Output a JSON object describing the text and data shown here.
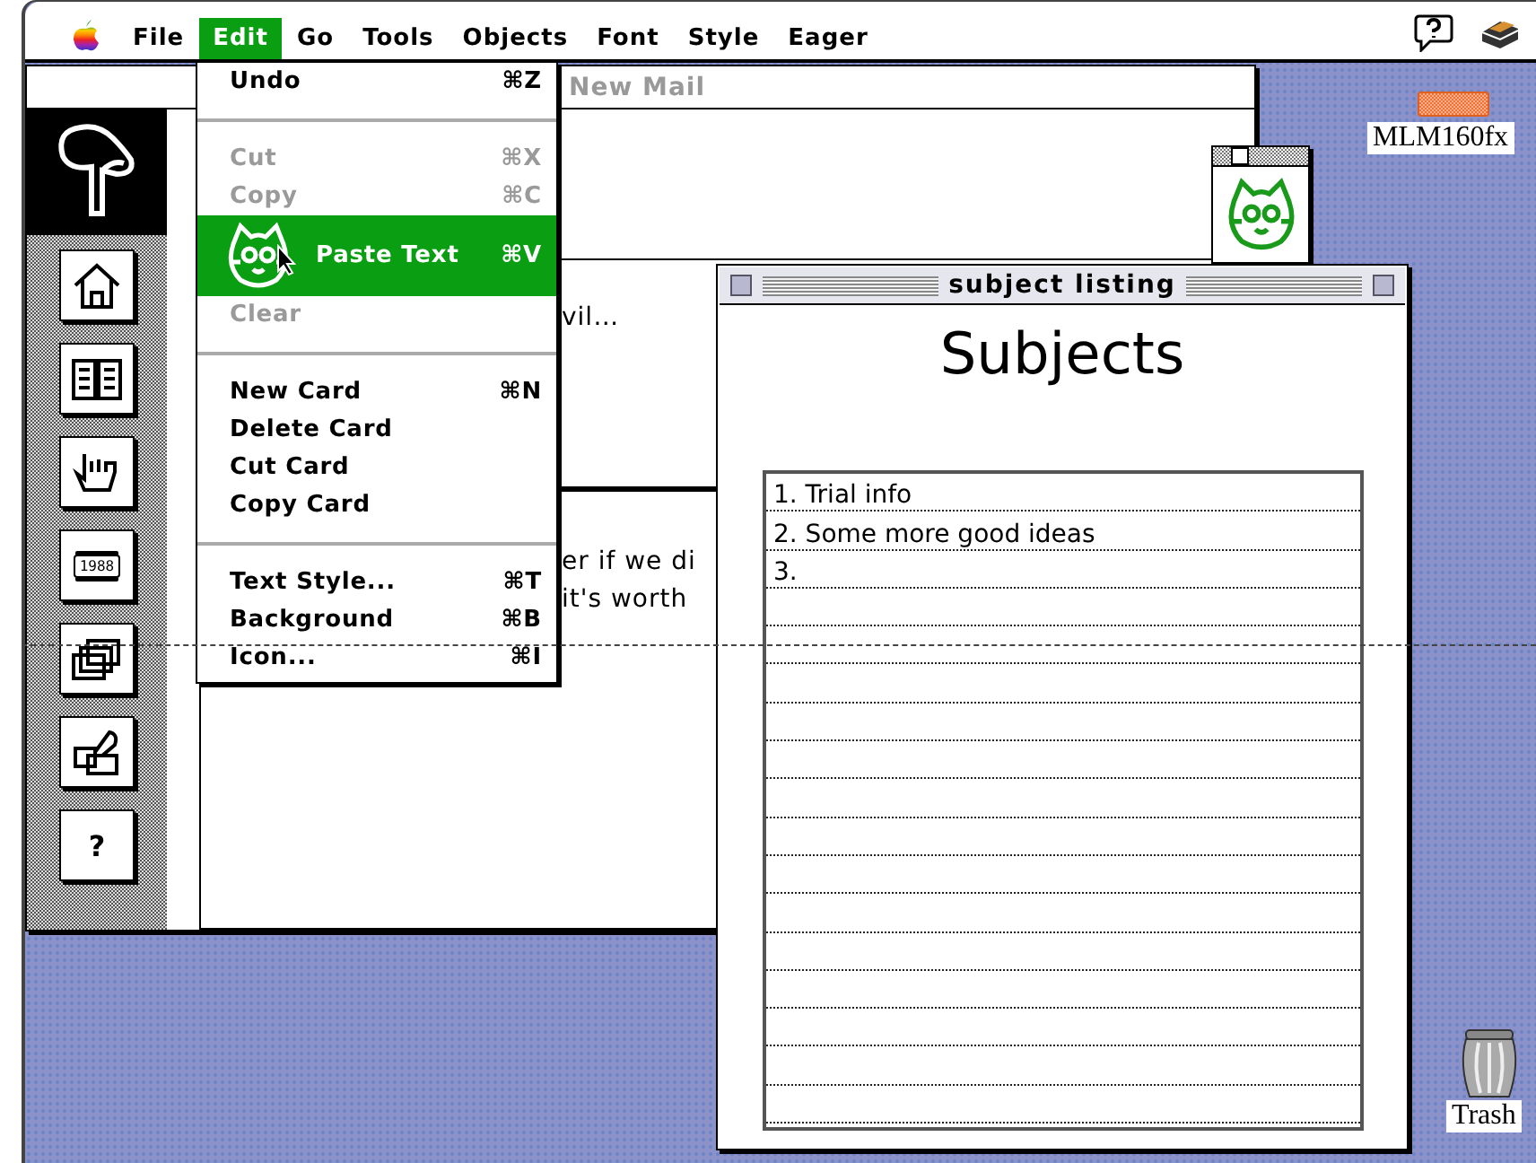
{
  "menu_bar": {
    "menus": [
      {
        "label": "File",
        "selected": false
      },
      {
        "label": "Edit",
        "selected": true
      },
      {
        "label": "Go",
        "selected": false
      },
      {
        "label": "Tools",
        "selected": false
      },
      {
        "label": "Objects",
        "selected": false
      },
      {
        "label": "Font",
        "selected": false
      },
      {
        "label": "Style",
        "selected": false
      },
      {
        "label": "Eager",
        "selected": false
      }
    ]
  },
  "edit_menu": {
    "items": [
      {
        "kind": "item",
        "label": "Undo",
        "shortcut": "⌘Z",
        "disabled": false,
        "highlighted": false
      },
      {
        "kind": "separator"
      },
      {
        "kind": "item",
        "label": "Cut",
        "shortcut": "⌘X",
        "disabled": true,
        "highlighted": false
      },
      {
        "kind": "item",
        "label": "Copy",
        "shortcut": "⌘C",
        "disabled": true,
        "highlighted": false
      },
      {
        "kind": "cat-item",
        "label": "Paste Text",
        "shortcut": "⌘V",
        "disabled": false,
        "highlighted": true
      },
      {
        "kind": "item",
        "label": "Clear",
        "disabled": true,
        "highlighted": false
      },
      {
        "kind": "separator"
      },
      {
        "kind": "item",
        "label": "New Card",
        "shortcut": "⌘N",
        "disabled": false,
        "highlighted": false
      },
      {
        "kind": "item",
        "label": "Delete Card",
        "disabled": false,
        "highlighted": false
      },
      {
        "kind": "item",
        "label": "Cut Card",
        "disabled": false,
        "highlighted": false
      },
      {
        "kind": "item",
        "label": "Copy Card",
        "disabled": false,
        "highlighted": false
      },
      {
        "kind": "separator"
      },
      {
        "kind": "item",
        "label": "Text Style...",
        "shortcut": "⌘T",
        "disabled": false,
        "highlighted": false
      },
      {
        "kind": "item",
        "label": "Background",
        "shortcut": "⌘B",
        "disabled": false,
        "highlighted": false
      },
      {
        "kind": "item",
        "label": "Icon...",
        "shortcut": "⌘I",
        "disabled": false,
        "highlighted": false
      }
    ]
  },
  "mail_window": {
    "title": "New Mail",
    "sidebar_buttons": [
      {
        "kind": "home"
      },
      {
        "kind": "book"
      },
      {
        "kind": "hand"
      },
      {
        "kind": "calendar",
        "label": "1988"
      },
      {
        "kind": "cards"
      },
      {
        "kind": "writing"
      },
      {
        "kind": "help",
        "label": "?"
      }
    ],
    "card_boxes": [
      {
        "lines": [
          "vil…"
        ]
      },
      {
        "lines": [
          "er if we di",
          "it's worth"
        ]
      }
    ]
  },
  "subject_window": {
    "title": "subject listing",
    "heading": "Subjects",
    "lines": [
      "1. Trial info",
      "2. Some more good ideas",
      "3."
    ]
  },
  "desktop_icons": [
    {
      "kind": "disk",
      "label": "MLM160fx"
    },
    {
      "kind": "trash",
      "label": "Trash"
    }
  ]
}
